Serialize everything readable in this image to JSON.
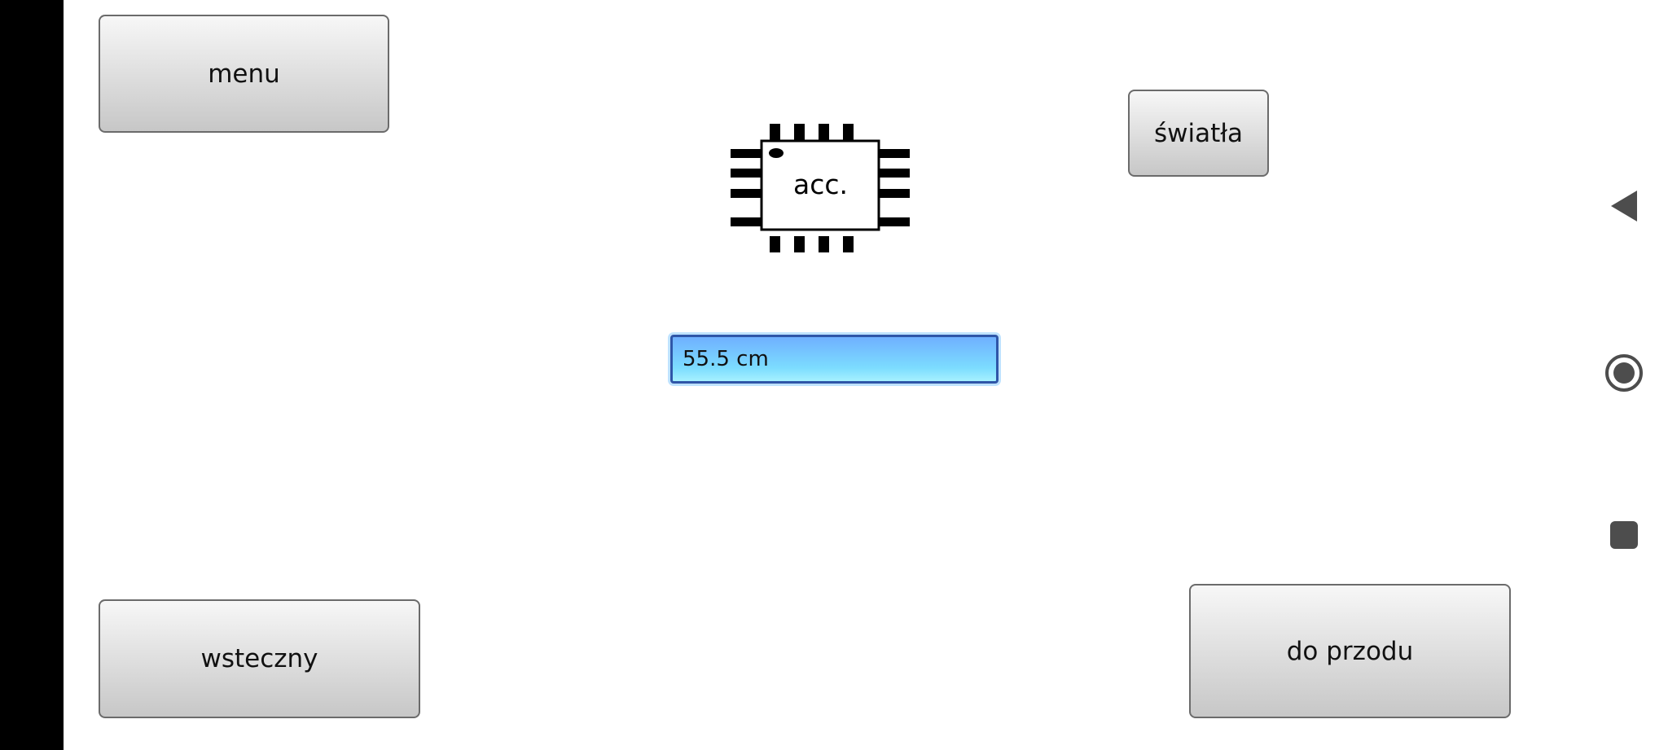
{
  "buttons": {
    "menu": "menu",
    "lights": "światła",
    "back": "wsteczny",
    "forward": "do przodu"
  },
  "sensor": {
    "label": "acc.",
    "icon": "chip-icon",
    "distance": "55.5 cm"
  },
  "navigation": {
    "back_icon": "back-triangle-icon",
    "home_icon": "home-circle-icon",
    "recents_icon": "recents-square-icon"
  }
}
